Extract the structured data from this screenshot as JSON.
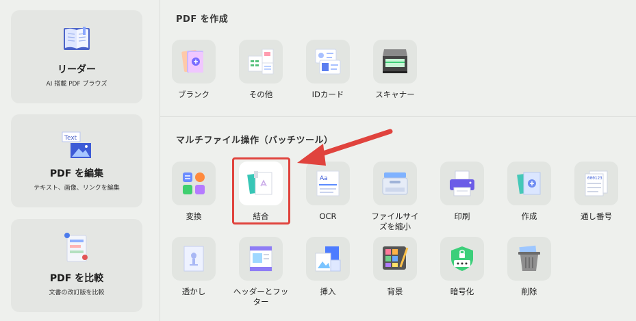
{
  "sidebar": {
    "cards": [
      {
        "title": "リーダー",
        "subtitle": "AI 搭載 PDF ブラウズ",
        "icon": "book-icon"
      },
      {
        "title": "PDF を編集",
        "subtitle": "テキスト、画像、リンクを編集",
        "icon": "edit-text-image-icon"
      },
      {
        "title": "PDF を比較",
        "subtitle": "文書の改訂版を比較",
        "icon": "compare-document-icon"
      }
    ]
  },
  "create": {
    "title": "PDF を作成",
    "tools": [
      {
        "label": "ブランク",
        "icon": "blank-page-icon"
      },
      {
        "label": "その他",
        "icon": "other-documents-icon"
      },
      {
        "label": "IDカード",
        "icon": "id-card-icon"
      },
      {
        "label": "スキャナー",
        "icon": "scanner-icon"
      }
    ]
  },
  "batch": {
    "title": "マルチファイル操作（バッチツール）",
    "tools": [
      {
        "label": "変換",
        "icon": "convert-apps-icon"
      },
      {
        "label": "結合",
        "icon": "combine-icon",
        "selected": true
      },
      {
        "label": "OCR",
        "icon": "ocr-icon"
      },
      {
        "label": "ファイルサイズを縮小",
        "icon": "compress-icon"
      },
      {
        "label": "印刷",
        "icon": "printer-icon"
      },
      {
        "label": "作成",
        "icon": "create-pdf-icon"
      },
      {
        "label": "通し番号",
        "icon": "bates-number-icon"
      },
      {
        "label": "透かし",
        "icon": "watermark-icon"
      },
      {
        "label": "ヘッダーとフッター",
        "icon": "header-footer-icon"
      },
      {
        "label": "挿入",
        "icon": "insert-icon"
      },
      {
        "label": "背景",
        "icon": "background-icon"
      },
      {
        "label": "暗号化",
        "icon": "encrypt-lock-icon"
      },
      {
        "label": "削除",
        "icon": "trash-icon"
      }
    ]
  },
  "overlay": {
    "highlight_color": "#e0433d"
  }
}
